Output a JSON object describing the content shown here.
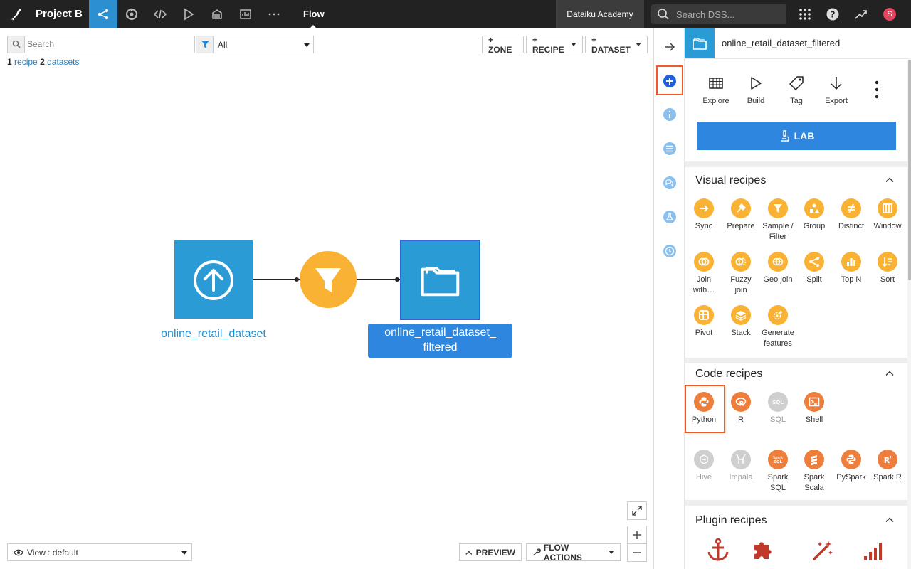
{
  "topbar": {
    "project_name": "Project B",
    "flow_title": "Flow",
    "academy_label": "Dataiku Academy",
    "search_placeholder": "Search DSS...",
    "avatar_initial": "S"
  },
  "canvas": {
    "search_placeholder": "Search",
    "filter_value": "All",
    "counts": {
      "recipes_n": "1",
      "recipes_label": "recipe",
      "datasets_n": "2",
      "datasets_label": "datasets"
    },
    "buttons": {
      "zone": "+ ZONE",
      "recipe": "+ RECIPE",
      "dataset": "+ DATASET"
    },
    "nodes": {
      "source_label": "online_retail_dataset",
      "output_label_line1": "online_retail_dataset_",
      "output_label_line2": "filtered"
    },
    "view_select": "View : default",
    "preview_label": "PREVIEW",
    "flow_actions_label": "FLOW ACTIONS"
  },
  "panel": {
    "title": "online_retail_dataset_filtered",
    "actions": [
      "Explore",
      "Build",
      "Tag",
      "Export"
    ],
    "lab_label": "LAB",
    "visual_title": "Visual recipes",
    "visual": [
      [
        "Sync",
        ""
      ],
      [
        "Prepare",
        ""
      ],
      [
        "Sample /",
        "Filter"
      ],
      [
        "Group",
        ""
      ],
      [
        "Distinct",
        ""
      ],
      [
        "Window",
        ""
      ],
      [
        "Join",
        "with…"
      ],
      [
        "Fuzzy",
        "join"
      ],
      [
        "Geo join",
        ""
      ],
      [
        "Split",
        ""
      ],
      [
        "Top N",
        ""
      ],
      [
        "Sort",
        ""
      ],
      [
        "Pivot",
        ""
      ],
      [
        "Stack",
        ""
      ],
      [
        "Generate",
        "features"
      ]
    ],
    "code_title": "Code recipes",
    "code": [
      [
        "Python",
        ""
      ],
      [
        "R",
        ""
      ],
      [
        "SQL",
        ""
      ],
      [
        "Shell",
        ""
      ],
      [
        "Hive",
        ""
      ],
      [
        "Impala",
        ""
      ],
      [
        "Spark",
        "SQL"
      ],
      [
        "Spark",
        "Scala"
      ],
      [
        "PySpark",
        ""
      ],
      [
        "Spark R",
        ""
      ]
    ],
    "plugin_title": "Plugin recipes",
    "colors": {
      "visual": "#f9b233",
      "code": "#ee7e3c",
      "disabled": "#cfcfcf",
      "plugin": "#c0392b",
      "highlight": "#f05a28"
    }
  }
}
